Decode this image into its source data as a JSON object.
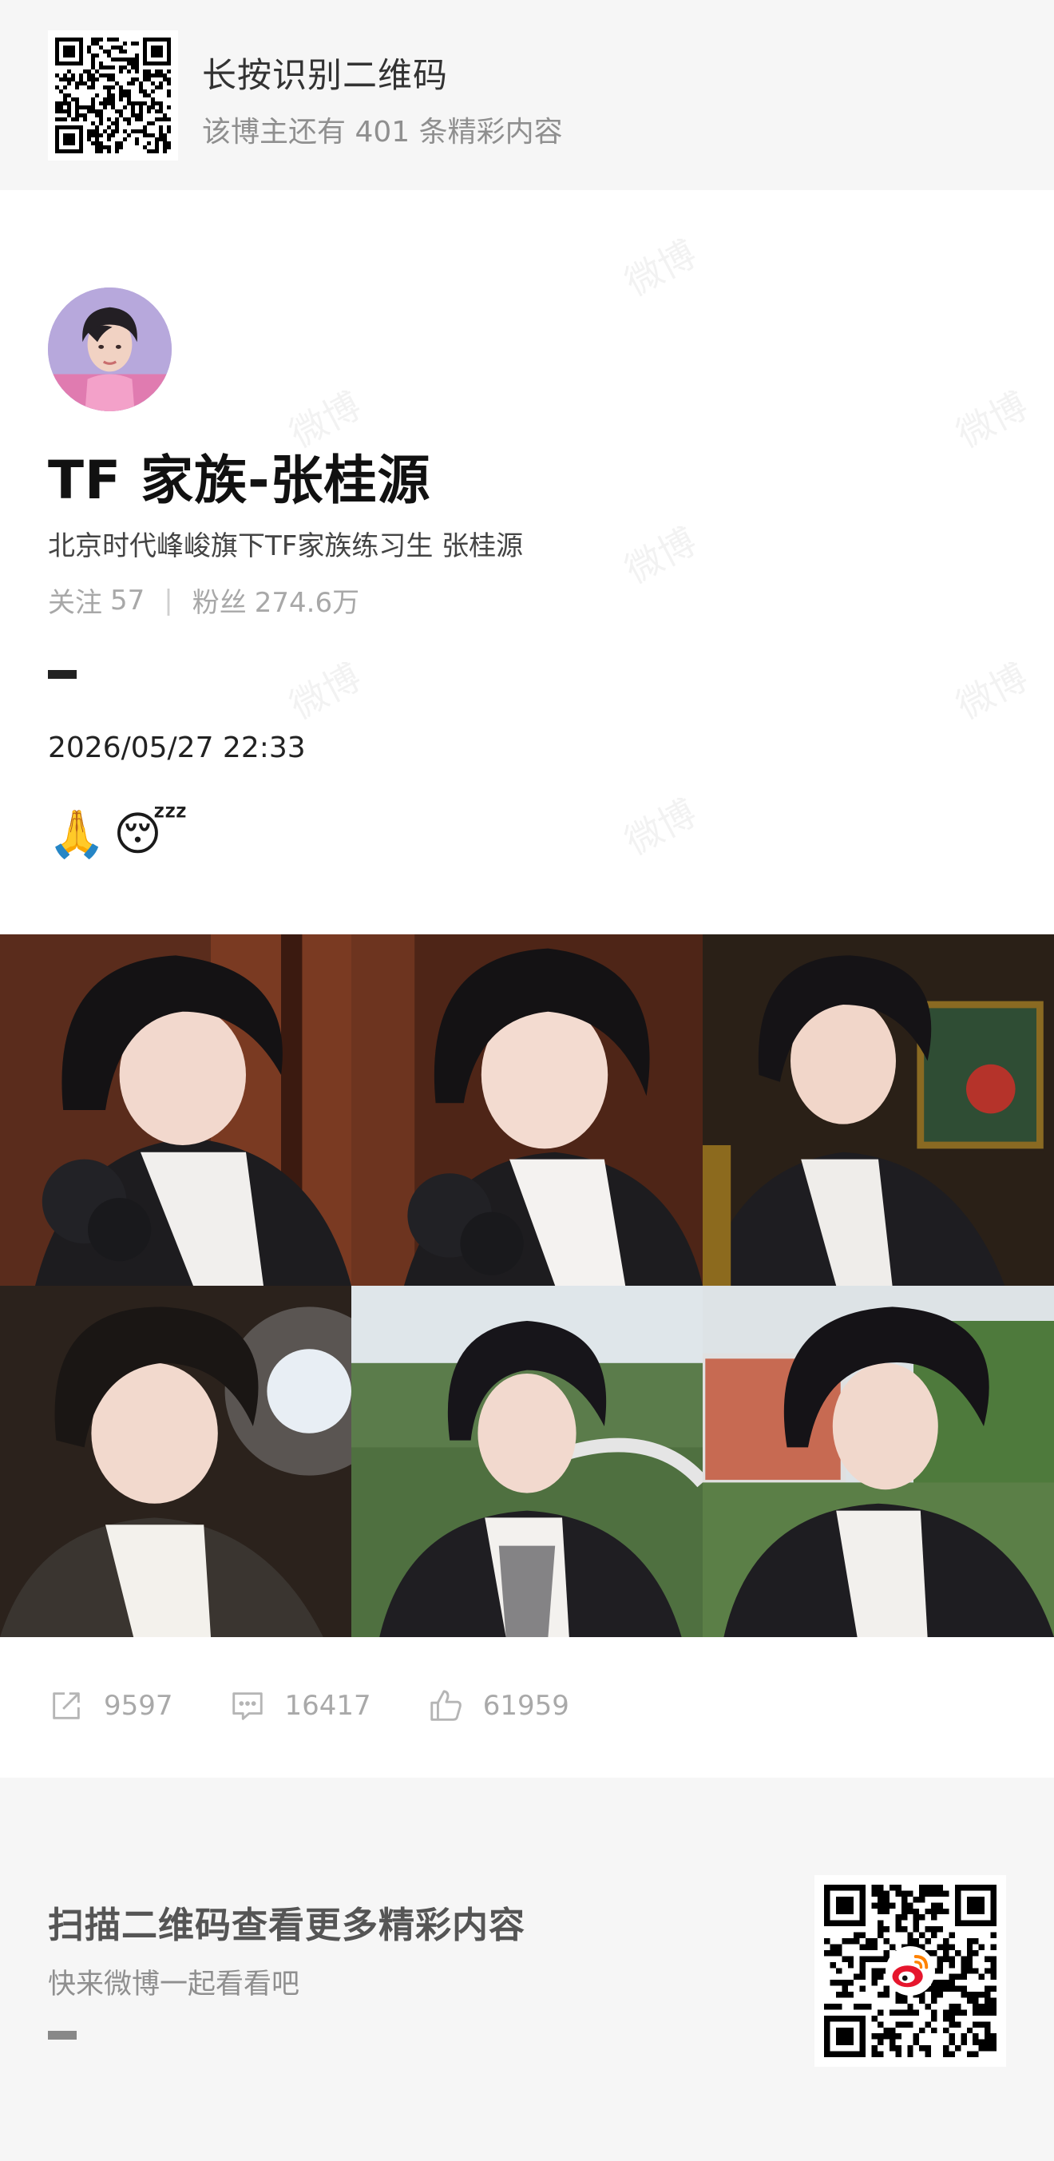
{
  "banner": {
    "title": "长按识别二维码",
    "subtitle": "该博主还有 401 条精彩内容"
  },
  "profile": {
    "name": "TF 家族-张桂源",
    "description": "北京时代峰峻旗下TF家族练习生  张桂源",
    "following_label": "关注",
    "following_count": "57",
    "separator": "|",
    "followers_label": "粉丝",
    "followers_count": "274.6万"
  },
  "post": {
    "timestamp": "2026/05/27 22:33",
    "emojis": [
      "🙏",
      "😴"
    ],
    "photos": [
      {
        "scene": "dark-wood-rose",
        "icon": "portrait-photo"
      },
      {
        "scene": "dark-wood-rose",
        "icon": "portrait-photo"
      },
      {
        "scene": "stained-glass",
        "icon": "portrait-photo"
      },
      {
        "scene": "dark-lights",
        "icon": "portrait-photo"
      },
      {
        "scene": "outdoor-green",
        "icon": "portrait-photo"
      },
      {
        "scene": "outdoor-building",
        "icon": "portrait-photo"
      }
    ]
  },
  "actions": {
    "repost_count": "9597",
    "comment_count": "16417",
    "like_count": "61959"
  },
  "footer": {
    "title": "扫描二维码查看更多精彩内容",
    "subtitle": "快来微博一起看看吧"
  },
  "watermark_text": "微博",
  "colors": {
    "panel_bg": "#f6f6f6",
    "muted_text": "#a8a8a8",
    "weibo_red": "#e6162d",
    "weibo_orange": "#ff8200"
  }
}
